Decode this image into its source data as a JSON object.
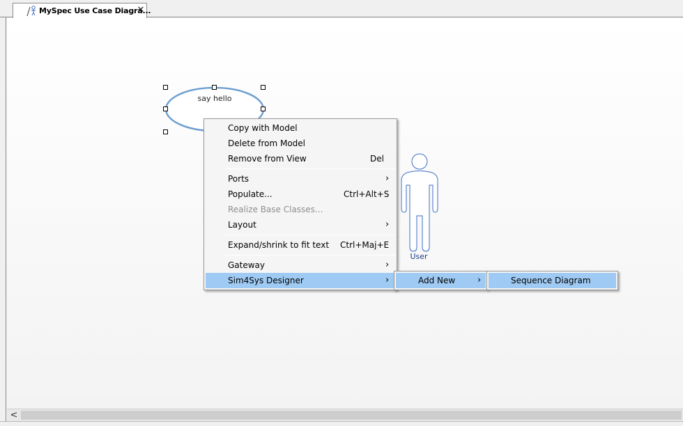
{
  "tab": {
    "title": "MySpec Use Case Diagra...",
    "icon": "use-case-diagram-icon",
    "close": "✕"
  },
  "diagram": {
    "usecase_label": "say hello",
    "actor_label": "User"
  },
  "context_menu": {
    "items": [
      {
        "label": "Copy with Model",
        "shortcut": ""
      },
      {
        "label": "Delete from Model",
        "shortcut": ""
      },
      {
        "label": "Remove from View",
        "shortcut": "Del"
      },
      {
        "label": "Ports",
        "submenu": true
      },
      {
        "label": "Populate...",
        "shortcut": "Ctrl+Alt+S"
      },
      {
        "label": "Realize Base Classes...",
        "disabled": true
      },
      {
        "label": "Layout",
        "submenu": true
      },
      {
        "label": "Expand/shrink to fit text",
        "shortcut": "Ctrl+Maj+E"
      },
      {
        "label": "Gateway",
        "submenu": true
      },
      {
        "label": "Sim4Sys Designer",
        "submenu": true,
        "highlighted": true
      }
    ]
  },
  "submenu_sim4sys": {
    "items": [
      {
        "label": "Add New",
        "submenu": true,
        "highlighted": true
      }
    ]
  },
  "submenu_add_new": {
    "items": [
      {
        "label": "Sequence Diagram",
        "highlighted": true
      }
    ]
  },
  "scrollbar": {
    "left_arrow": "<"
  },
  "colors": {
    "highlight": "#9fcaf3",
    "shape_stroke": "#6f9fd0",
    "actor_stroke": "#3b6fc4"
  }
}
